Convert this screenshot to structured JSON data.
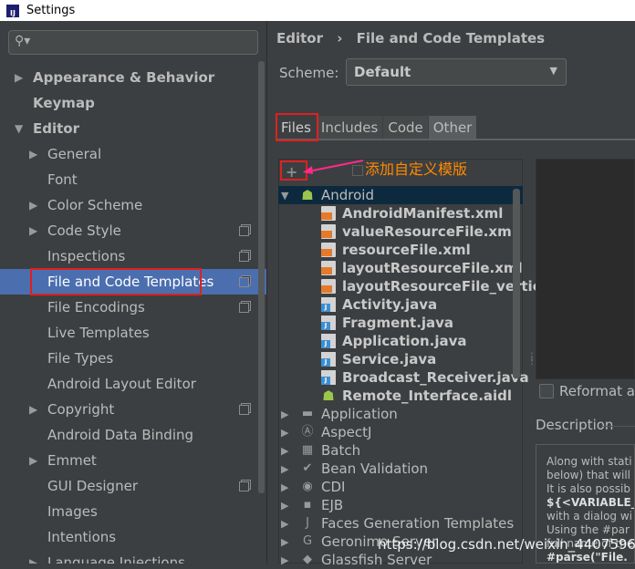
{
  "window": {
    "title": "Settings",
    "logo_text": "IJ"
  },
  "search": {
    "placeholder": "",
    "icon": "search-icon"
  },
  "sidebar": {
    "items": [
      {
        "label": "Appearance & Behavior",
        "level": 0,
        "expandable": true,
        "expanded": false,
        "bold": true
      },
      {
        "label": "Keymap",
        "level": 0,
        "expandable": false,
        "bold": true
      },
      {
        "label": "Editor",
        "level": 0,
        "expandable": true,
        "expanded": true,
        "bold": true
      },
      {
        "label": "General",
        "level": 1,
        "expandable": true
      },
      {
        "label": "Font",
        "level": 1,
        "expandable": false
      },
      {
        "label": "Color Scheme",
        "level": 1,
        "expandable": true
      },
      {
        "label": "Code Style",
        "level": 1,
        "expandable": true,
        "project": true
      },
      {
        "label": "Inspections",
        "level": 1,
        "expandable": false,
        "project": true
      },
      {
        "label": "File and Code Templates",
        "level": 1,
        "expandable": false,
        "project": true,
        "selected": true
      },
      {
        "label": "File Encodings",
        "level": 1,
        "expandable": false,
        "project": true
      },
      {
        "label": "Live Templates",
        "level": 1,
        "expandable": false
      },
      {
        "label": "File Types",
        "level": 1,
        "expandable": false
      },
      {
        "label": "Android Layout Editor",
        "level": 1,
        "expandable": false
      },
      {
        "label": "Copyright",
        "level": 1,
        "expandable": true,
        "project": true
      },
      {
        "label": "Android Data Binding",
        "level": 1,
        "expandable": false
      },
      {
        "label": "Emmet",
        "level": 1,
        "expandable": true
      },
      {
        "label": "GUI Designer",
        "level": 1,
        "expandable": false,
        "project": true
      },
      {
        "label": "Images",
        "level": 1,
        "expandable": false
      },
      {
        "label": "Intentions",
        "level": 1,
        "expandable": false
      },
      {
        "label": "Language Injections",
        "level": 1,
        "expandable": true
      }
    ]
  },
  "breadcrumb": {
    "parent": "Editor",
    "separator": "›",
    "current": "File and Code Templates"
  },
  "scheme": {
    "label": "Scheme:",
    "value": "Default"
  },
  "tabs": [
    {
      "label": "Files",
      "active": true
    },
    {
      "label": "Includes",
      "active": false
    },
    {
      "label": "Code",
      "active": false
    },
    {
      "label": "Other",
      "active": false
    }
  ],
  "toolbar": {
    "add_label": "+",
    "annotation": "添加自定义模版"
  },
  "templates": {
    "root": {
      "label": "Android",
      "expanded": true
    },
    "children": [
      {
        "label": "AndroidManifest.xml",
        "type": "xml"
      },
      {
        "label": "valueResourceFile.xml",
        "type": "xml"
      },
      {
        "label": "resourceFile.xml",
        "type": "xml"
      },
      {
        "label": "layoutResourceFile.xml",
        "type": "xml"
      },
      {
        "label": "layoutResourceFile_vertical.x",
        "type": "xml"
      },
      {
        "label": "Activity.java",
        "type": "java"
      },
      {
        "label": "Fragment.java",
        "type": "java"
      },
      {
        "label": "Application.java",
        "type": "java"
      },
      {
        "label": "Service.java",
        "type": "java"
      },
      {
        "label": "Broadcast_Receiver.java",
        "type": "java"
      },
      {
        "label": "Remote_Interface.aidl",
        "type": "android"
      }
    ],
    "groups": [
      {
        "label": "Application",
        "icon": "folder"
      },
      {
        "label": "AspectJ",
        "icon": "aspectj"
      },
      {
        "label": "Batch",
        "icon": "batch"
      },
      {
        "label": "Bean Validation",
        "icon": "bean"
      },
      {
        "label": "CDI",
        "icon": "cdi"
      },
      {
        "label": "EJB",
        "icon": "ejb"
      },
      {
        "label": "Faces Generation Templates",
        "icon": "jsf"
      },
      {
        "label": "Geronimo Server",
        "icon": "geronimo"
      },
      {
        "label": "Glassfish Server",
        "icon": "glassfish"
      }
    ]
  },
  "reformat": {
    "label": "Reformat ac"
  },
  "description": {
    "label": "Description",
    "lines": [
      {
        "text": "Along with stati",
        "bold": false
      },
      {
        "text": "below) that will",
        "bold": false
      },
      {
        "text": "It is also possib",
        "bold": false
      },
      {
        "text": "${<VARIABLE_",
        "bold": true
      },
      {
        "text": "with a dialog wi",
        "bold": false
      },
      {
        "text": "Using the #par",
        "bold": false
      },
      {
        "text": "full name of the",
        "bold": false
      },
      {
        "text": "#parse(\"File.",
        "bold": true
      }
    ]
  },
  "watermark": "https://blog.csdn.net/weixin_44075963",
  "colors": {
    "selection": "#4b6eaf",
    "highlight_box": "#e02020",
    "annotation": "#ff8a00",
    "background": "#3c3f41"
  }
}
